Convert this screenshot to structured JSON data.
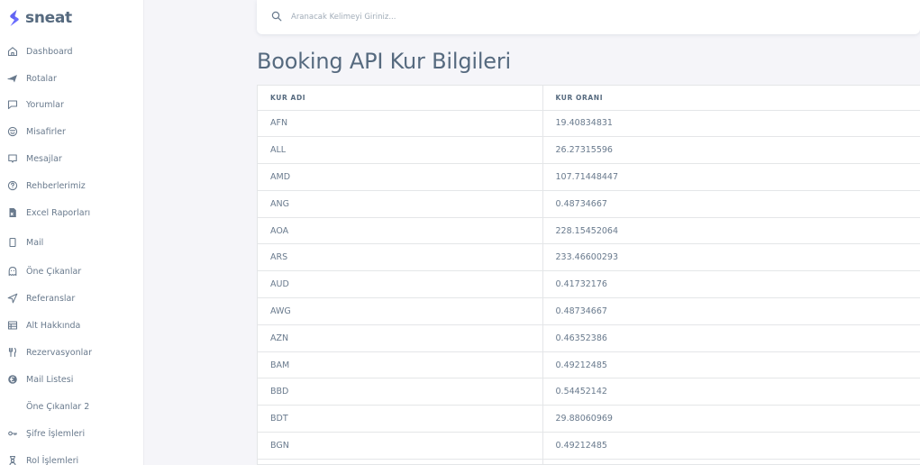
{
  "brand": {
    "name": "sneat",
    "accent": "#696cff"
  },
  "sidebar": {
    "items": [
      {
        "label": "Dashboard",
        "icon": "home-icon"
      },
      {
        "label": "Rotalar",
        "icon": "plane-icon"
      },
      {
        "label": "Yorumlar",
        "icon": "comment-icon"
      },
      {
        "label": "Misafirler",
        "icon": "smile-icon"
      },
      {
        "label": "Mesajlar",
        "icon": "message-icon"
      },
      {
        "label": "Rehberlerimiz",
        "icon": "question-icon"
      },
      {
        "label": "Excel Raporları",
        "icon": "excel-file-icon"
      },
      {
        "label": "Mail",
        "icon": "mobile-icon"
      },
      {
        "label": "Öne Çıkanlar",
        "icon": "ghost-icon"
      },
      {
        "label": "Referanslar",
        "icon": "send-icon"
      },
      {
        "label": "Alt Hakkında",
        "icon": "layout-icon"
      },
      {
        "label": "Rezervasyonlar",
        "icon": "restaurant-icon"
      },
      {
        "label": "Mail Listesi",
        "icon": "euro-icon"
      },
      {
        "label": "Öne Çıkanlar 2",
        "icon": ""
      },
      {
        "label": "Şifre İşlemleri",
        "icon": "key-icon"
      },
      {
        "label": "Rol İşlemleri",
        "icon": "user-badge-icon"
      }
    ]
  },
  "search": {
    "placeholder": "Aranacak Kelimeyi Giriniz..."
  },
  "page": {
    "title": "Booking API Kur Bilgileri"
  },
  "table": {
    "headers": [
      "KUR ADI",
      "KUR ORANI"
    ],
    "rows": [
      [
        "AFN",
        "19.40834831"
      ],
      [
        "ALL",
        "26.27315596"
      ],
      [
        "AMD",
        "107.71448447"
      ],
      [
        "ANG",
        "0.48734667"
      ],
      [
        "AOA",
        "228.15452064"
      ],
      [
        "ARS",
        "233.46600293"
      ],
      [
        "AUD",
        "0.41732176"
      ],
      [
        "AWG",
        "0.48734667"
      ],
      [
        "AZN",
        "0.46352386"
      ],
      [
        "BAM",
        "0.49212485"
      ],
      [
        "BBD",
        "0.54452142"
      ],
      [
        "BDT",
        "29.88060969"
      ],
      [
        "BGN",
        "0.49212485"
      ]
    ]
  }
}
